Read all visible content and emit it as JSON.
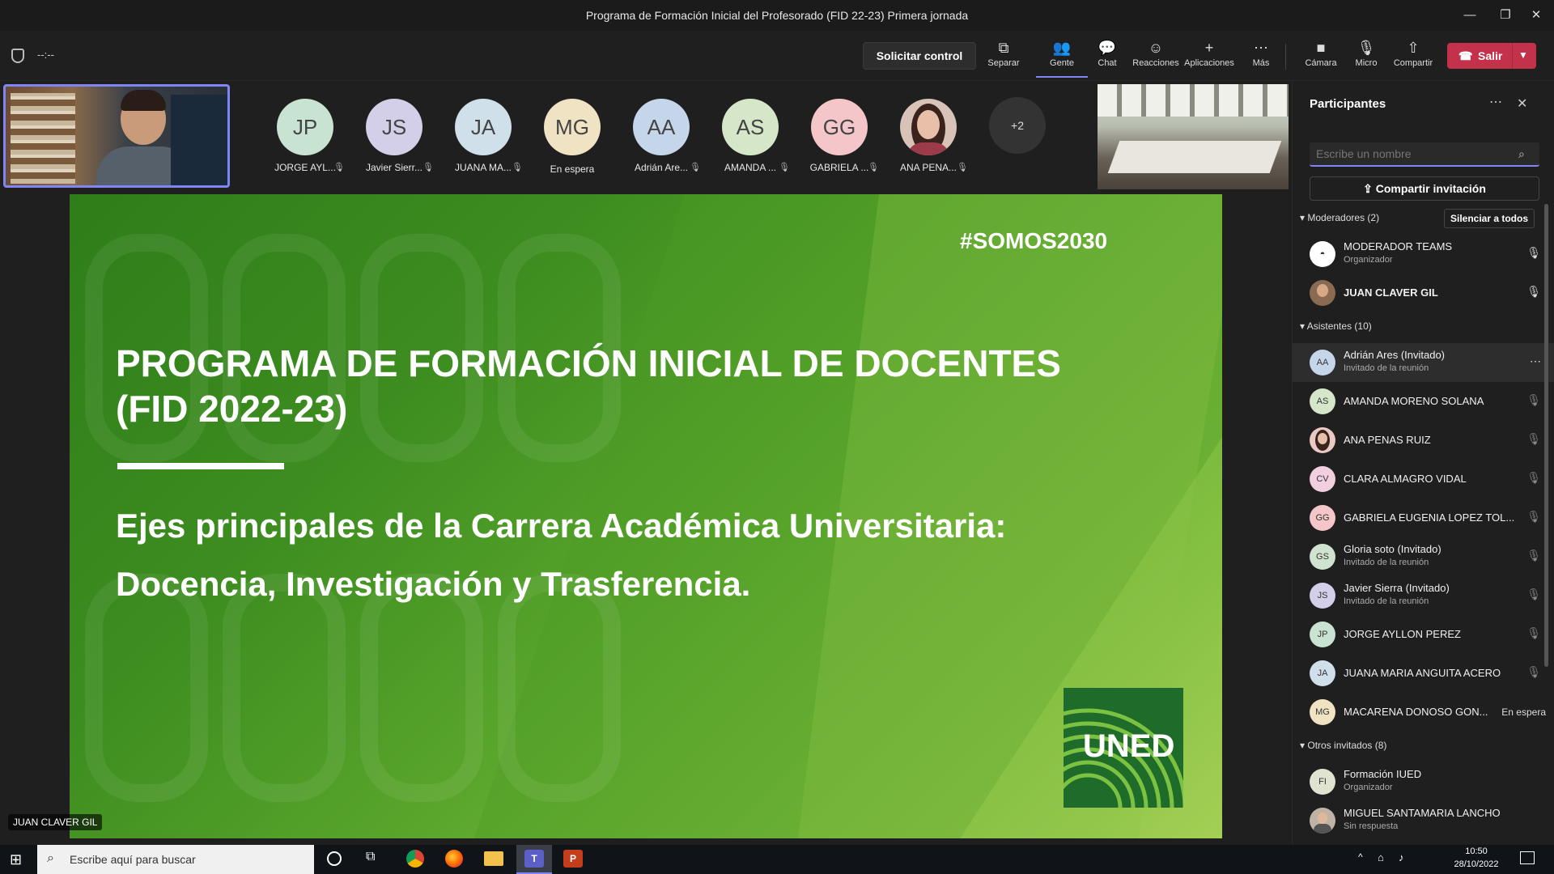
{
  "window": {
    "title": "Programa de Formación Inicial del Profesorado (FID 22-23) Primera jornada",
    "minimize_glyph": "—",
    "restore_glyph": "❐",
    "close_glyph": "✕"
  },
  "toolbar": {
    "timer": "--:--",
    "request_control": "Solicitar control",
    "buttons": [
      {
        "label": "Separar",
        "icon": "pop-out-icon"
      },
      {
        "label": "Gente",
        "icon": "people-icon"
      },
      {
        "label": "Chat",
        "icon": "chat-icon"
      },
      {
        "label": "Reacciones",
        "icon": "reactions-icon"
      },
      {
        "label": "Aplicaciones",
        "icon": "plus-icon"
      },
      {
        "label": "Más",
        "icon": "more-icon"
      },
      {
        "label": "Cámara",
        "icon": "camera-icon"
      },
      {
        "label": "Micro",
        "icon": "microphone-icon"
      },
      {
        "label": "Compartir",
        "icon": "share-icon"
      }
    ],
    "leave": "Salir"
  },
  "gallery": {
    "tiles": [
      {
        "initials": "JP",
        "label": "JORGE AYL...",
        "color": "#c9e3d3"
      },
      {
        "initials": "JS",
        "label": "Javier Sierr...",
        "color": "#d3cfe8"
      },
      {
        "initials": "JA",
        "label": "JUANA MA...",
        "color": "#cfe0ea"
      },
      {
        "initials": "MG",
        "label": "En espera",
        "color": "#efe3c4"
      },
      {
        "initials": "AA",
        "label": "Adrián Are...",
        "color": "#c6d6ea"
      },
      {
        "initials": "AS",
        "label": "AMANDA ...",
        "color": "#d6e6c9"
      },
      {
        "initials": "GG",
        "label": "GABRIELA ...",
        "color": "#f4c6c9"
      },
      {
        "initials": "",
        "label": "ANA PENA...",
        "color": "#e9c9c4"
      }
    ],
    "overflow": "+2"
  },
  "presenter_name": "JUAN CLAVER GIL",
  "slide": {
    "hashtag": "#SOMOS2030",
    "title_line1": "PROGRAMA DE FORMACIÓN INICIAL DE DOCENTES",
    "title_line2": "(FID 2022-23)",
    "subtitle_line1": "Ejes principales de la Carrera Académica Universitaria:",
    "subtitle_line2": "Docencia, Investigación y Trasferencia.",
    "logo_text": "UNED"
  },
  "panel": {
    "title": "Participantes",
    "search_placeholder": "Escribe un nombre",
    "share_invite": "Compartir invitación",
    "mute_all": "Silenciar a todos",
    "moderators_header": "Moderadores (2)",
    "attendees_header": "Asistentes (10)",
    "others_header": "Otros invitados (8)",
    "moderators": [
      {
        "name": "MODERADOR TEAMS",
        "sub": "Organizador",
        "initials": ""
      },
      {
        "name": "JUAN CLAVER GIL",
        "sub": "",
        "initials": ""
      }
    ],
    "attendees": [
      {
        "initials": "AA",
        "name": "Adrián Ares (Invitado)",
        "sub": "Invitado de la reunión",
        "color": "#c6d6ea"
      },
      {
        "initials": "AS",
        "name": "AMANDA MORENO SOLANA",
        "sub": "",
        "color": "#d6e6c9"
      },
      {
        "initials": "",
        "name": "ANA PENAS RUIZ",
        "sub": "",
        "color": "#e9c9c4"
      },
      {
        "initials": "CV",
        "name": "CLARA ALMAGRO VIDAL",
        "sub": "",
        "color": "#f2cfe0"
      },
      {
        "initials": "GG",
        "name": "GABRIELA EUGENIA LOPEZ TOL...",
        "sub": "",
        "color": "#f4c6c9"
      },
      {
        "initials": "GS",
        "name": "Gloria soto (Invitado)",
        "sub": "Invitado de la reunión",
        "color": "#d0e3d0"
      },
      {
        "initials": "JS",
        "name": "Javier Sierra (Invitado)",
        "sub": "Invitado de la reunión",
        "color": "#d3cfe8"
      },
      {
        "initials": "JP",
        "name": "JORGE AYLLON PEREZ",
        "sub": "",
        "color": "#c9e3d3"
      },
      {
        "initials": "JA",
        "name": "JUANA MARIA ANGUITA ACERO",
        "sub": "",
        "color": "#cfe0ea"
      },
      {
        "initials": "MG",
        "name": "MACARENA DONOSO GON...",
        "sub": "",
        "color": "#efe3c4",
        "status": "En espera"
      }
    ],
    "others": [
      {
        "initials": "FI",
        "name": "Formación IUED",
        "sub": "Organizador",
        "color": "#dfe3d0"
      },
      {
        "initials": "",
        "name": "MIGUEL SANTAMARIA LANCHO",
        "sub": "Sin respuesta",
        "color": "#bfb3a6"
      }
    ]
  },
  "taskbar": {
    "search_placeholder": "Escribe aquí para buscar",
    "time": "10:50",
    "date": "28/10/2022"
  }
}
